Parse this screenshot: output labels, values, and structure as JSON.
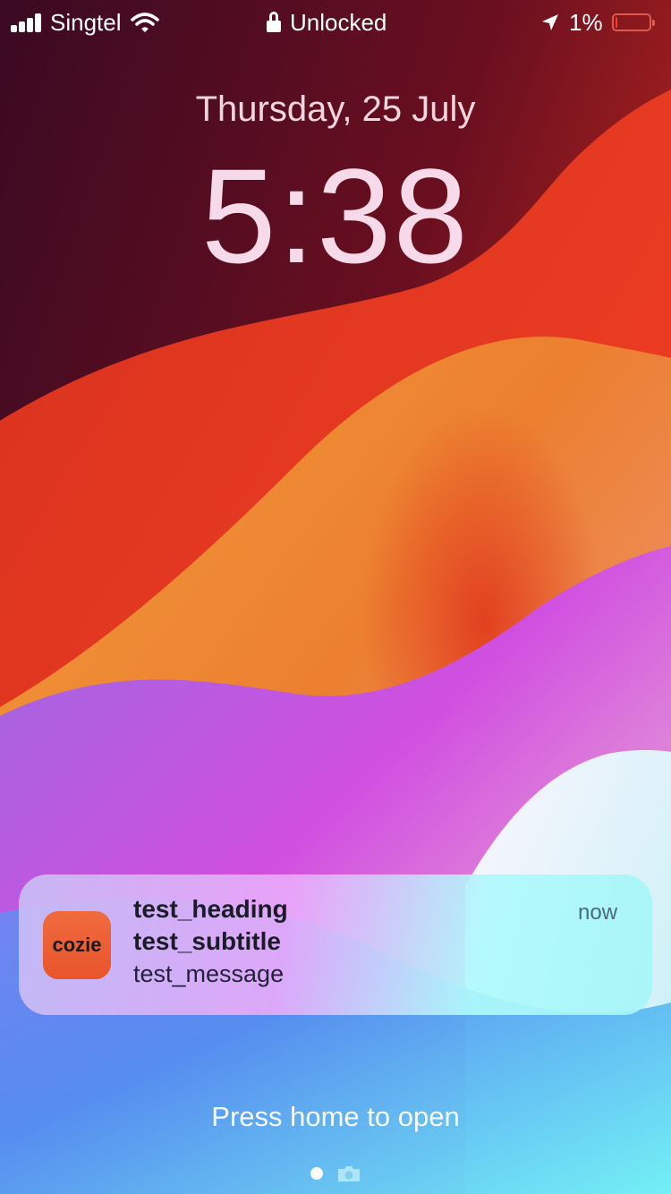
{
  "status_bar": {
    "carrier": "Singtel",
    "lock_status": "Unlocked",
    "battery_percent_label": "1%",
    "battery_level": 0.01,
    "icons": [
      "cellular-signal-icon",
      "wifi-icon",
      "lock-icon",
      "location-arrow-icon",
      "battery-icon"
    ]
  },
  "lock_screen": {
    "date": "Thursday, 25 July",
    "time": "5:38"
  },
  "notification": {
    "app_icon_label": "cozie",
    "heading": "test_heading",
    "subtitle": "test_subtitle",
    "message": "test_message",
    "time": "now"
  },
  "footer": {
    "hint": "Press home to open",
    "icons": [
      "page-dot-icon",
      "camera-icon"
    ]
  },
  "colors": {
    "battery_low": "#ff3b30",
    "app_icon": "#ec5f33"
  }
}
